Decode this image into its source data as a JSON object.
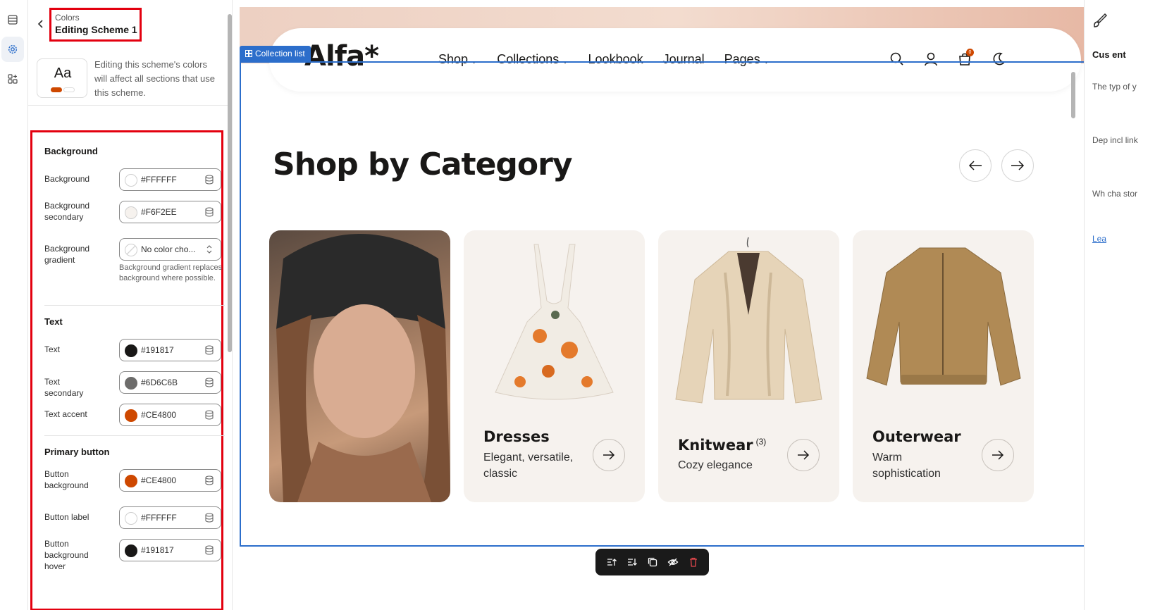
{
  "panel": {
    "breadcrumb": "Colors",
    "title": "Editing Scheme 1",
    "preview_label": "Aa",
    "description": "Editing this scheme's colors will affect all sections that use this scheme."
  },
  "sections": {
    "background": {
      "title": "Background",
      "fields": [
        {
          "label": "Background",
          "value": "#FFFFFF"
        },
        {
          "label": "Background secondary",
          "value": "#F6F2EE"
        },
        {
          "label": "Background gradient",
          "value": "No color cho...",
          "help": "Background gradient replaces background where possible."
        }
      ]
    },
    "text": {
      "title": "Text",
      "fields": [
        {
          "label": "Text",
          "value": "#191817"
        },
        {
          "label": "Text secondary",
          "value": "#6D6C6B"
        },
        {
          "label": "Text accent",
          "value": "#CE4800"
        }
      ]
    },
    "primary_button": {
      "title": "Primary button",
      "fields": [
        {
          "label": "Button background",
          "value": "#CE4800"
        },
        {
          "label": "Button label",
          "value": "#FFFFFF"
        },
        {
          "label": "Button background hover",
          "value": "#191817"
        }
      ]
    }
  },
  "store": {
    "logo": "Alfa*",
    "nav": [
      "Shop",
      "Collections",
      "Lookbook",
      "Journal",
      "Pages"
    ],
    "cart_count": "0"
  },
  "selection": {
    "tag": "Collection list"
  },
  "collection_list": {
    "heading": "Shop by Category",
    "cards": [
      {
        "name": "Dresses",
        "desc": "Elegant, versatile, classic"
      },
      {
        "name": "Knitwear",
        "count": "(3)",
        "desc": "Cozy elegance"
      },
      {
        "name": "Outerwear",
        "desc": "Warm sophistication"
      }
    ]
  },
  "help": {
    "title": "Cus ent",
    "paragraphs": [
      "The typ of y",
      "Dep incl link",
      "Wh cha stor"
    ],
    "link": "Lea"
  },
  "colors": {
    "accent": "#CE4800",
    "text": "#191817",
    "text_secondary": "#6D6C6B",
    "background_secondary": "#F6F2EE",
    "selection": "#2c6ecb",
    "highlight": "#e3000f"
  }
}
